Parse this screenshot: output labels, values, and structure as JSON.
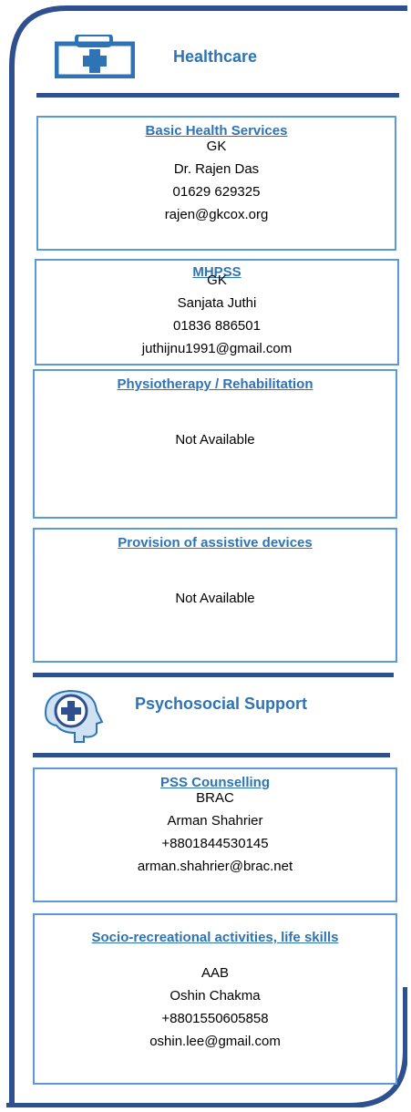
{
  "sections": {
    "healthcare": {
      "title": "Healthcare",
      "icon": "medical-kit-icon"
    },
    "psychosocial": {
      "title": "Psychosocial Support",
      "icon": "head-medical-cross-icon"
    }
  },
  "services": {
    "basic_health": {
      "title": "Basic Health Services",
      "org": "GK",
      "contact": "Dr. Rajen Das",
      "phone": "01629 629325",
      "email": "rajen@gkcox.org"
    },
    "mhpss": {
      "title": "MHPSS",
      "org": "GK",
      "contact": "Sanjata Juthi",
      "phone": "01836 886501",
      "email": "juthijnu1991@gmail.com"
    },
    "physio": {
      "title": "Physiotherapy / Rehabilitation",
      "status": "Not Available"
    },
    "assistive": {
      "title": "Provision of assistive devices",
      "status": "Not Available"
    },
    "pss_counselling": {
      "title": "PSS Counselling",
      "org": "BRAC",
      "contact": "Arman Shahrier",
      "phone": "+8801844530145",
      "email": "arman.shahrier@brac.net"
    },
    "socio_recreational": {
      "title": "Socio-recreational activities, life skills",
      "org": "AAB",
      "contact": "Oshin Chakma",
      "phone": "+8801550605858",
      "email": "oshin.lee@gmail.com"
    }
  },
  "colors": {
    "accent": "#2e74b5",
    "box_border": "#5b9bd5",
    "frame": "#2f4f8f"
  }
}
